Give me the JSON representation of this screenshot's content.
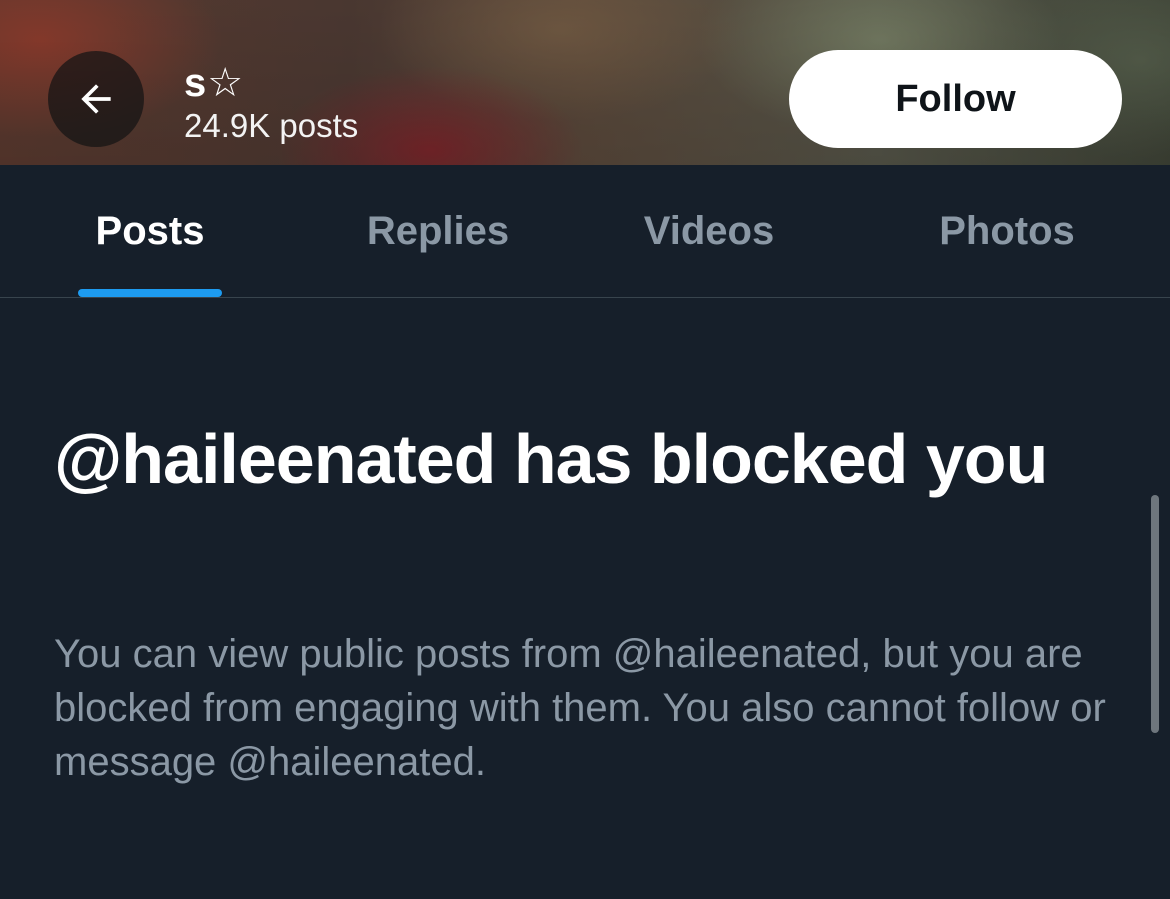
{
  "header": {
    "back_icon": "arrow-left-icon",
    "name": "s☆",
    "post_count": "24.9K posts",
    "follow_label": "Follow"
  },
  "tabs": [
    {
      "label": "Posts",
      "active": true
    },
    {
      "label": "Replies",
      "active": false
    },
    {
      "label": "Videos",
      "active": false
    },
    {
      "label": "Photos",
      "active": false
    }
  ],
  "blocked": {
    "title": "@haileenated has blocked you",
    "description": "You can view public posts from @haileenated, but you are blocked from engaging with them. You also cannot follow or message @haileenated."
  },
  "colors": {
    "background": "#161f2a",
    "accent": "#1d9bf0",
    "muted_text": "#8b98a5",
    "divider": "#38444d"
  }
}
